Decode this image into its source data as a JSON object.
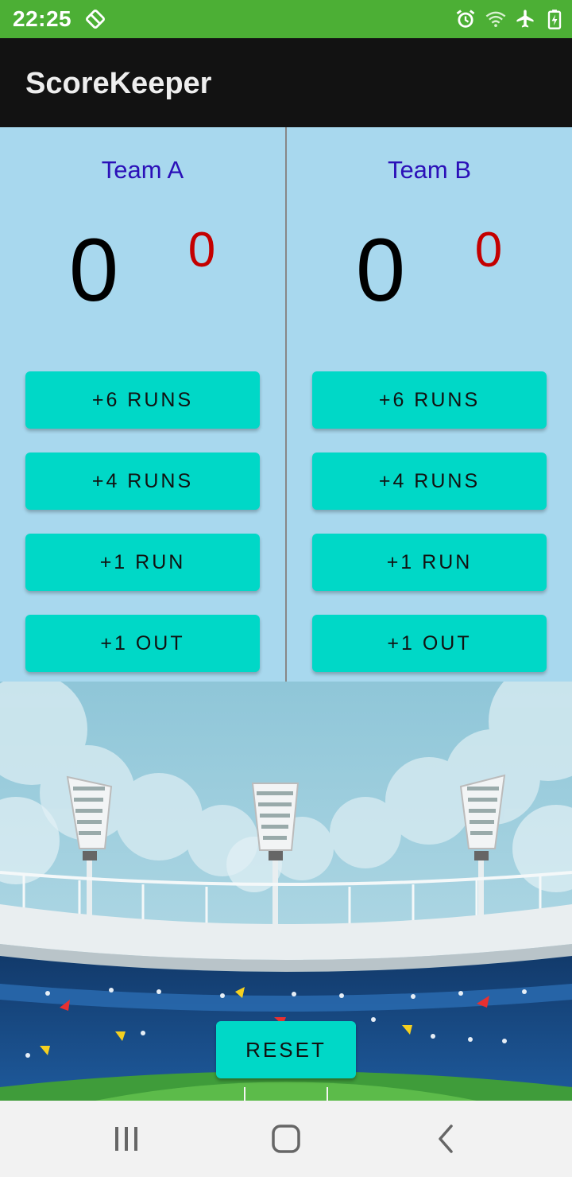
{
  "status_bar": {
    "time": "22:25",
    "icons": [
      "sync-off-icon",
      "alarm-icon",
      "wifi-icon",
      "airplane-icon",
      "battery-charging-icon"
    ]
  },
  "app_bar": {
    "title": "ScoreKeeper"
  },
  "teams": [
    {
      "name": "Team A",
      "score": "0",
      "outs": "0",
      "buttons": {
        "six": "+6 RUNS",
        "four": "+4 RUNS",
        "one": "+1 RUN",
        "out": "+1 OUT"
      }
    },
    {
      "name": "Team B",
      "score": "0",
      "outs": "0",
      "buttons": {
        "six": "+6 RUNS",
        "four": "+4 RUNS",
        "one": "+1 RUN",
        "out": "+1 OUT"
      }
    }
  ],
  "reset_label": "RESET",
  "nav_bar": {
    "icons": [
      "recents-icon",
      "home-icon",
      "back-icon"
    ]
  },
  "colors": {
    "status_bar": "#4caf35",
    "app_bar": "#121212",
    "panel_bg": "#a8d8ee",
    "team_name": "#2b10b8",
    "outs": "#c40000",
    "button": "#00d8c7"
  }
}
